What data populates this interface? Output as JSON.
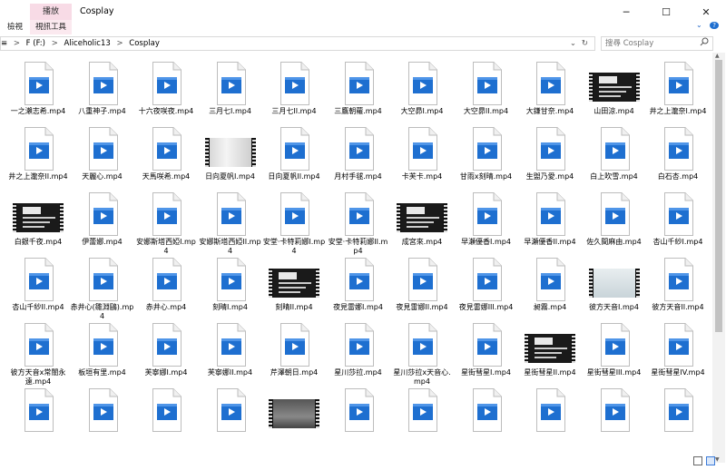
{
  "window": {
    "context_tab": "播放",
    "title": "Cosplay",
    "minimize": "─",
    "maximize": "☐",
    "close": "✕"
  },
  "ribbon": {
    "tabs": [
      "檢視",
      "視訊工具"
    ],
    "chevron": "⌄",
    "help": "?"
  },
  "address": {
    "crumbs": [
      "F (F:)",
      "Aliceholic13",
      "Cosplay"
    ],
    "separator": ">",
    "start_glyph": "≡",
    "dropdown": "⌄",
    "refresh": "↻"
  },
  "search": {
    "placeholder": "搜尋 Cosplay",
    "icon": "search-icon"
  },
  "colors": {
    "accent": "#1e6fd0",
    "context_tab": "#f8dbe6"
  },
  "files": [
    {
      "name": "一之瀨志希.mp4",
      "kind": "doc"
    },
    {
      "name": "八重神子.mp4",
      "kind": "doc"
    },
    {
      "name": "十六夜咲夜.mp4",
      "kind": "doc"
    },
    {
      "name": "三月七I.mp4",
      "kind": "doc"
    },
    {
      "name": "三月七II.mp4",
      "kind": "doc"
    },
    {
      "name": "三鷹朝蘿.mp4",
      "kind": "doc"
    },
    {
      "name": "大空昴I.mp4",
      "kind": "doc"
    },
    {
      "name": "大空昴II.mp4",
      "kind": "doc"
    },
    {
      "name": "大鎌甘奈.mp4",
      "kind": "doc"
    },
    {
      "name": "山田涼.mp4",
      "kind": "thumb",
      "style": "dark-card"
    },
    {
      "name": "井之上瀧奈I.mp4",
      "kind": "doc"
    },
    {
      "name": "井之上瀧奈II.mp4",
      "kind": "doc"
    },
    {
      "name": "天麗心.mp4",
      "kind": "doc"
    },
    {
      "name": "天馬咲希.mp4",
      "kind": "doc"
    },
    {
      "name": "日向夏帆I.mp4",
      "kind": "thumb",
      "style": "light-photo"
    },
    {
      "name": "日向夏帆II.mp4",
      "kind": "doc"
    },
    {
      "name": "月村手毬.mp4",
      "kind": "doc"
    },
    {
      "name": "卡芙卡.mp4",
      "kind": "doc"
    },
    {
      "name": "甘雨x刻晴.mp4",
      "kind": "doc"
    },
    {
      "name": "生盥乃愛.mp4",
      "kind": "doc"
    },
    {
      "name": "白上吹雪.mp4",
      "kind": "doc"
    },
    {
      "name": "白石杏.mp4",
      "kind": "doc"
    },
    {
      "name": "白銀千夜.mp4",
      "kind": "thumb",
      "style": "dark-card"
    },
    {
      "name": "伊蕾娜.mp4",
      "kind": "doc"
    },
    {
      "name": "安娜斯塔西婭I.mp4",
      "kind": "doc"
    },
    {
      "name": "安娜斯塔西婭II.mp4",
      "kind": "doc"
    },
    {
      "name": "安堂·卡特莉娜I.mp4",
      "kind": "doc"
    },
    {
      "name": "安堂·卡特莉娜II.mp4",
      "kind": "doc"
    },
    {
      "name": "成宮來.mp4",
      "kind": "thumb",
      "style": "dark-card"
    },
    {
      "name": "早瀬優香I.mp4",
      "kind": "doc"
    },
    {
      "name": "早瀬優香II.mp4",
      "kind": "doc"
    },
    {
      "name": "佐久間麻由.mp4",
      "kind": "doc"
    },
    {
      "name": "杏山千紗I.mp4",
      "kind": "doc"
    },
    {
      "name": "杏山千紗II.mp4",
      "kind": "doc"
    },
    {
      "name": "赤井心(雛淵鷗).mp4",
      "kind": "doc"
    },
    {
      "name": "赤井心.mp4",
      "kind": "doc"
    },
    {
      "name": "刻晴I.mp4",
      "kind": "doc"
    },
    {
      "name": "刻晴II.mp4",
      "kind": "thumb",
      "style": "dark-card"
    },
    {
      "name": "夜見雷娜I.mp4",
      "kind": "doc"
    },
    {
      "name": "夜見雷娜II.mp4",
      "kind": "doc"
    },
    {
      "name": "夜見雷娜III.mp4",
      "kind": "doc"
    },
    {
      "name": "昶霧.mp4",
      "kind": "doc"
    },
    {
      "name": "彼方天音I.mp4",
      "kind": "thumb",
      "style": "light-room"
    },
    {
      "name": "彼方天音II.mp4",
      "kind": "doc"
    },
    {
      "name": "彼方天音x常闇永遠.mp4",
      "kind": "doc"
    },
    {
      "name": "板垣有里.mp4",
      "kind": "doc"
    },
    {
      "name": "芙寧娜I.mp4",
      "kind": "doc"
    },
    {
      "name": "芙寧娜II.mp4",
      "kind": "doc"
    },
    {
      "name": "芹澤朝日.mp4",
      "kind": "doc"
    },
    {
      "name": "星川莎拉.mp4",
      "kind": "doc"
    },
    {
      "name": "星川莎拉x天音心.mp4",
      "kind": "doc"
    },
    {
      "name": "星街彗星I.mp4",
      "kind": "doc"
    },
    {
      "name": "星街彗星II.mp4",
      "kind": "thumb",
      "style": "dark-card"
    },
    {
      "name": "星街彗星III.mp4",
      "kind": "doc"
    },
    {
      "name": "星街彗星IV.mp4",
      "kind": "doc"
    },
    {
      "name": "",
      "kind": "doc"
    },
    {
      "name": "",
      "kind": "doc"
    },
    {
      "name": "",
      "kind": "doc"
    },
    {
      "name": "",
      "kind": "doc"
    },
    {
      "name": "",
      "kind": "thumb",
      "style": "dim-photo"
    },
    {
      "name": "",
      "kind": "doc"
    },
    {
      "name": "",
      "kind": "doc"
    },
    {
      "name": "",
      "kind": "doc"
    },
    {
      "name": "",
      "kind": "doc"
    },
    {
      "name": "",
      "kind": "doc"
    },
    {
      "name": "",
      "kind": "doc"
    }
  ]
}
